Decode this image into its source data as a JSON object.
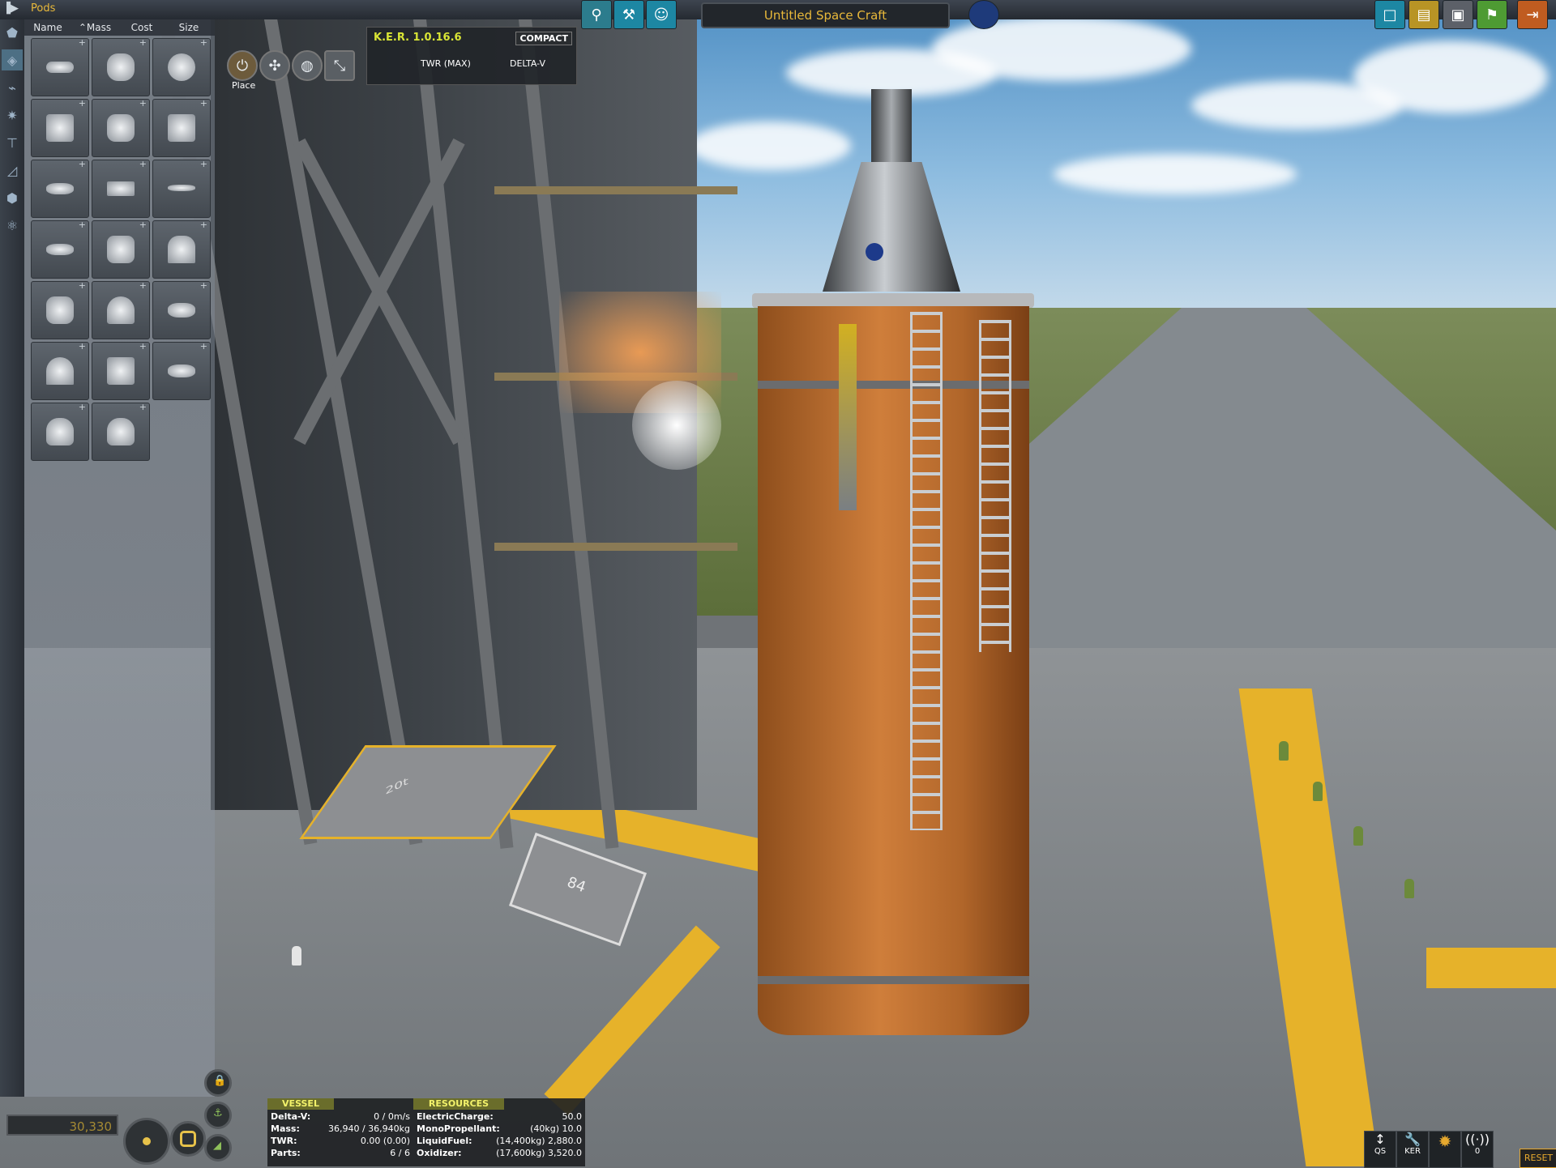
{
  "top_bar": {
    "category_label": "Pods",
    "vessel_name": "Untitled Space Craft",
    "left_buttons": [
      "action-groups-icon",
      "wrench-hammer-icon",
      "crew-icon"
    ],
    "flag_icon": "nasa-flag-icon",
    "right_buttons": [
      "new-icon",
      "load-icon",
      "save-icon",
      "launch-icon",
      "exit-icon"
    ]
  },
  "sidebar": {
    "filters": [
      "pods-filter",
      "fuel-tanks-filter",
      "engines-filter",
      "control-filter",
      "structural-filter",
      "aero-filter",
      "utility-filter",
      "science-filter"
    ]
  },
  "sort": {
    "columns": [
      "Name",
      "Mass",
      "Cost",
      "Size"
    ],
    "active_indicator": "⌃"
  },
  "parts": [
    {
      "icon": "docking-port-icon"
    },
    {
      "icon": "antenna-icon"
    },
    {
      "icon": "sphere-icon"
    },
    {
      "icon": "cupola-icon"
    },
    {
      "icon": "pod-icon"
    },
    {
      "icon": "battery-icon"
    },
    {
      "icon": "decoupler-icon"
    },
    {
      "icon": "tank-icon"
    },
    {
      "icon": "heatshield-icon"
    },
    {
      "icon": "gear-icon"
    },
    {
      "icon": "lab-icon"
    },
    {
      "icon": "capsule-icon"
    },
    {
      "icon": "cockpit-icon"
    },
    {
      "icon": "nose-icon"
    },
    {
      "icon": "lander-icon"
    },
    {
      "icon": "cone-icon"
    },
    {
      "icon": "probe-icon"
    },
    {
      "icon": "dock-icon"
    },
    {
      "icon": "command-pod-icon"
    },
    {
      "icon": "capsule-mk1-icon"
    }
  ],
  "editor_modes": {
    "place_label": "Place",
    "buttons": [
      "place-icon",
      "offset-icon",
      "rotate-icon",
      "root-icon"
    ]
  },
  "ker": {
    "title": "K.E.R. 1.0.16.6",
    "compact_label": "COMPACT",
    "columns": [
      "TWR (MAX)",
      "DELTA-V"
    ]
  },
  "funds": {
    "value": "30,330"
  },
  "vessel_panel": {
    "header": "VESSEL",
    "rows": [
      {
        "label": "Delta-V:",
        "value": "0 / 0m/s"
      },
      {
        "label": "Mass:",
        "value": "36,940 / 36,940kg"
      },
      {
        "label": "TWR:",
        "value": "0.00 (0.00)"
      },
      {
        "label": "Parts:",
        "value": "6 / 6"
      }
    ]
  },
  "resources_panel": {
    "header": "RESOURCES",
    "rows": [
      {
        "label": "ElectricCharge:",
        "value": "50.0"
      },
      {
        "label": "MonoPropellant:",
        "value": "(40kg) 10.0"
      },
      {
        "label": "LiquidFuel:",
        "value": "(14,400kg) 2,880.0"
      },
      {
        "label": "Oxidizer:",
        "value": "(17,600kg) 3,520.0"
      }
    ]
  },
  "bottom_right": {
    "buttons": [
      {
        "icon": "quicksave-icon",
        "label": "QS"
      },
      {
        "icon": "ker-icon",
        "label": "KER"
      },
      {
        "icon": "settings-icon",
        "label": ""
      },
      {
        "icon": "signal-icon",
        "label": "0"
      }
    ],
    "reset_label": "RESET"
  },
  "world": {
    "marking_20": "20t",
    "marking_84": "84"
  },
  "colors": {
    "accent": "#e8b83a",
    "ker_title": "#d9e535",
    "panel_header": "#6a6d2b"
  }
}
